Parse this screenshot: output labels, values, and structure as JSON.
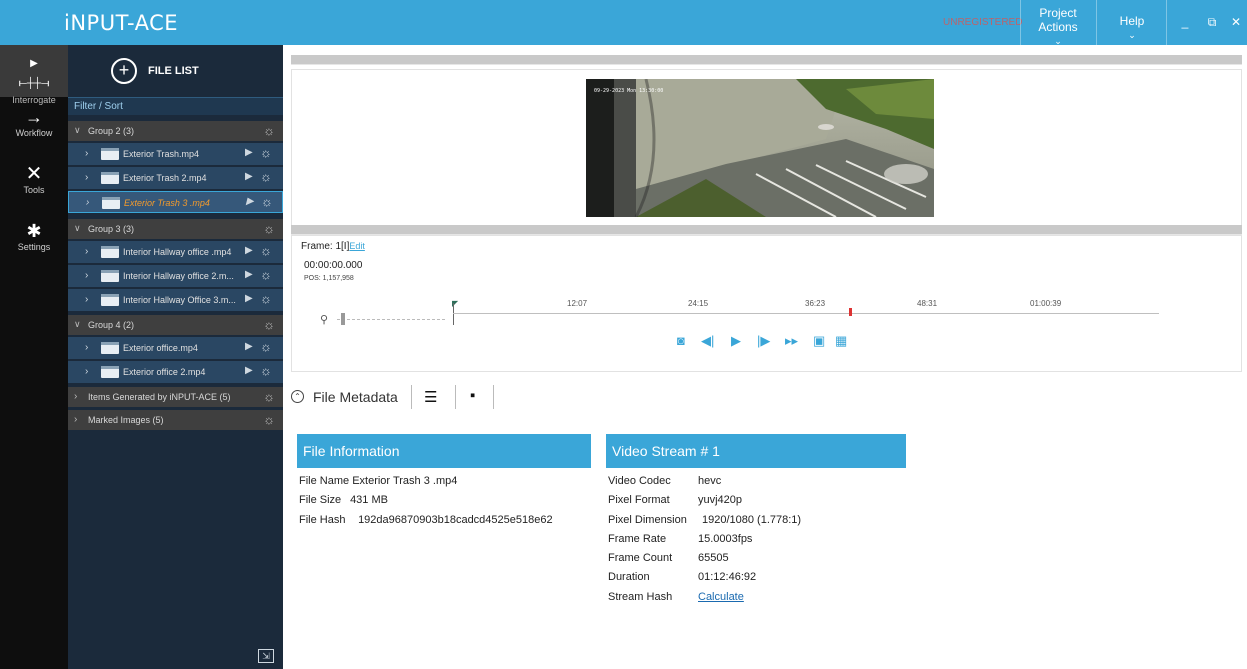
{
  "app": {
    "logo": "iNPUT-ACE",
    "red_tag": "UNREGISTERED",
    "menus": [
      {
        "label": "Project Actions"
      },
      {
        "label": "Help"
      }
    ],
    "window_controls": [
      "_",
      "⧉",
      "✕"
    ]
  },
  "rail": {
    "items": [
      {
        "label": "Interrogate"
      },
      {
        "label": "Workflow"
      },
      {
        "label": "Tools"
      },
      {
        "label": "Settings"
      }
    ]
  },
  "filelist": {
    "title": "FILE LIST",
    "filter_label": "Filter / Sort",
    "groups": [
      {
        "label": "Group 2 (3)",
        "files": [
          "Exterior Trash.mp4",
          "Exterior Trash 2.mp4",
          "Exterior Trash 3 .mp4"
        ]
      },
      {
        "label": "Group 3 (3)",
        "files": [
          "Interior Hallway office .mp4",
          "Interior Hallway office 2.m...",
          "Interior Hallway Office 3.m..."
        ]
      },
      {
        "label": "Group 4 (2)",
        "files": [
          "Exterior office.mp4",
          "Exterior office 2.mp4"
        ]
      }
    ],
    "extra_groups": [
      "Items Generated by iNPUT-ACE (5)",
      "Marked Images (5)"
    ],
    "selected_file": "Exterior Trash 3 .mp4"
  },
  "video": {
    "overlay_text": "09-29-2023  Mon 13:30:00"
  },
  "timeline": {
    "frame_label": "Frame:",
    "frame_value": "1[I]",
    "edit_link": "Edit",
    "timecode": "00:00:00.000",
    "pos": "POS: 1,157,958",
    "ticks": [
      "12:07",
      "24:15",
      "36:23",
      "48:31",
      "01:00:39"
    ]
  },
  "metadata": {
    "title": "File Metadata",
    "file_info": {
      "header": "File Information",
      "rows": [
        {
          "key": "File Name",
          "value": "Exterior Trash 3 .mp4"
        },
        {
          "key": "File Size",
          "value": "431 MB"
        },
        {
          "key": "File Hash",
          "value": "192da96870903b18cadcd4525e518e62"
        }
      ]
    },
    "video_stream": {
      "header": "Video Stream # 1",
      "rows": [
        {
          "key": "Video Codec",
          "value": "hevc"
        },
        {
          "key": "Pixel Format",
          "value": "yuvj420p"
        },
        {
          "key": "Pixel Dimension",
          "value": "1920/1080 (1.778:1)"
        },
        {
          "key": "Frame Rate",
          "value": "15.0003fps"
        },
        {
          "key": "Frame Count",
          "value": "65505"
        },
        {
          "key": "Duration",
          "value": "01:12:46:92"
        },
        {
          "key": "Stream Hash",
          "value": "Calculate"
        }
      ]
    }
  },
  "colors": {
    "accent": "#3aa6d8",
    "panel_dark": "#1b2a3b",
    "selected_file_text": "#f39b2d"
  }
}
